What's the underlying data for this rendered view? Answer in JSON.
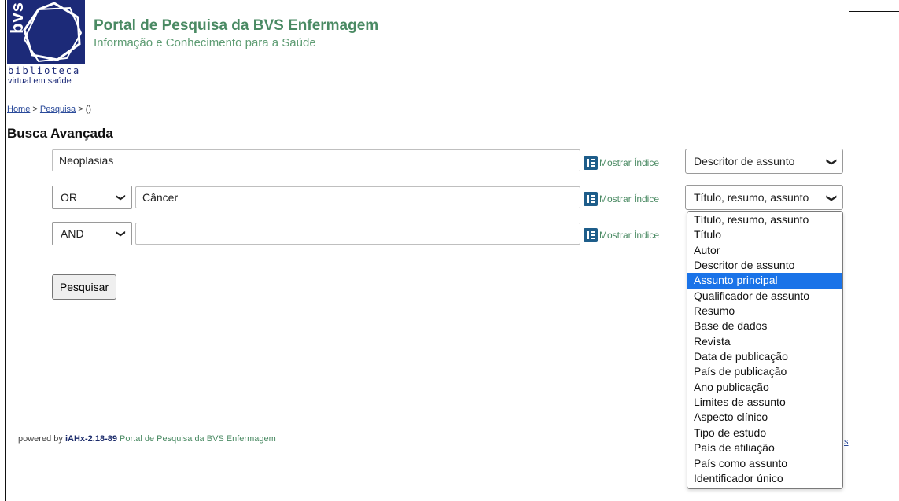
{
  "header": {
    "logo_word": "bvs",
    "logo_line1": "biblioteca",
    "logo_line2": "virtual em saúde",
    "title": "Portal de Pesquisa da BVS Enfermagem",
    "subtitle": "Informação e Conhecimento para a Saúde"
  },
  "breadcrumb": {
    "home": "Home",
    "sep": ">",
    "search": "Pesquisa",
    "current": "()"
  },
  "page_title": "Busca Avançada",
  "rows": [
    {
      "operator": "",
      "term": "Neoplasias",
      "index_label": "Mostrar Índice",
      "field": "Descritor de assunto"
    },
    {
      "operator": "OR",
      "term": "Câncer",
      "index_label": "Mostrar Índice",
      "field": "Título, resumo, assunto"
    },
    {
      "operator": "AND",
      "term": "",
      "index_label": "Mostrar Índice",
      "field": ""
    }
  ],
  "chevron": "❯",
  "submit_label": "Pesquisar",
  "dropdown": {
    "options": [
      "Título, resumo, assunto",
      "Título",
      "Autor",
      "Descritor de assunto",
      "Assunto principal",
      "Qualificador de assunto",
      "Resumo",
      "Base de dados",
      "Revista",
      "Data de publicação",
      "País de publicação",
      "Ano publicação",
      "Limites de assunto",
      "Aspecto clínico",
      "Tipo de estudo",
      "País de afiliação",
      "País como assunto",
      "Identificador único"
    ],
    "highlighted": "Assunto principal"
  },
  "footer": {
    "powered": "powered by",
    "version": "iAHx-2.18-89",
    "portal": "Portal de Pesquisa da BVS Enfermagem",
    "stray": "s"
  },
  "colors": {
    "brand_green": "#4a8a63",
    "logo_blue": "#1c2a78",
    "highlight": "#1a73e8"
  }
}
